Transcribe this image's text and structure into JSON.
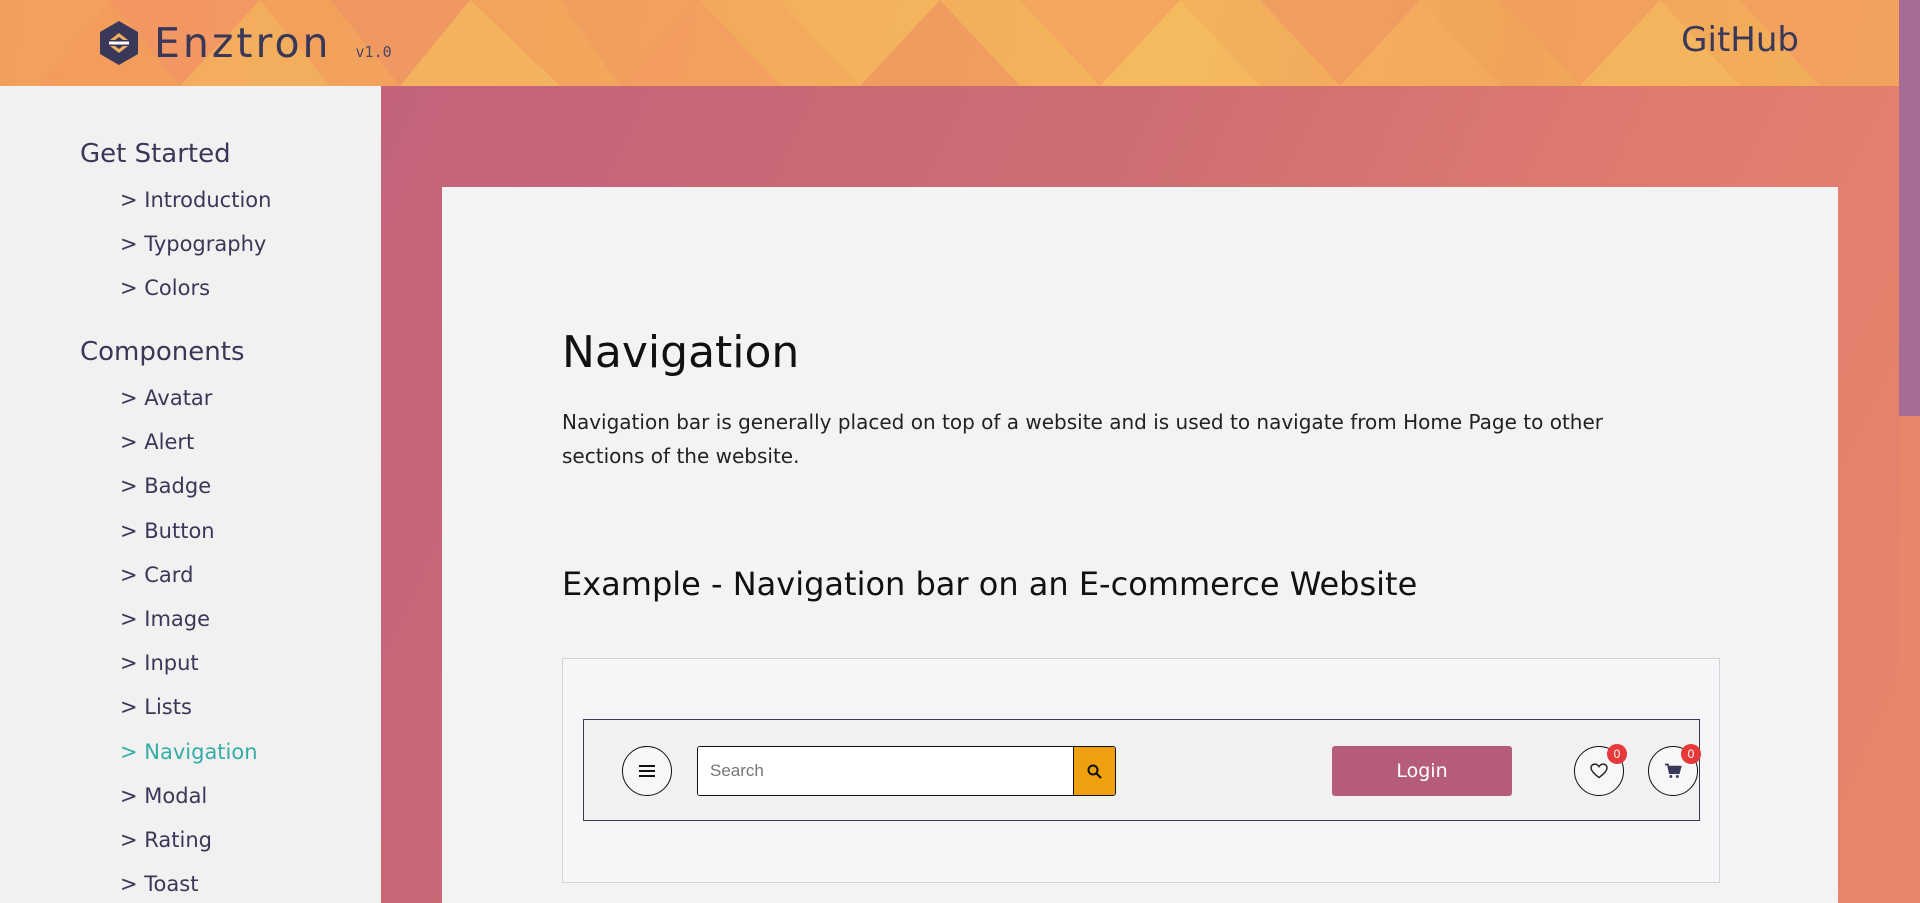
{
  "header": {
    "brand": "Enztron",
    "version": "v1.0",
    "github_label": "GitHub"
  },
  "sidebar": {
    "groups": [
      {
        "heading": "Get Started",
        "items": [
          "> Introduction",
          "> Typography",
          "> Colors"
        ]
      },
      {
        "heading": "Components",
        "items": [
          "> Avatar",
          "> Alert",
          "> Badge",
          "> Button",
          "> Card",
          "> Image",
          "> Input",
          "> Lists",
          "> Navigation",
          "> Modal",
          "> Rating",
          "> Toast"
        ]
      }
    ],
    "active_item": "> Navigation"
  },
  "main": {
    "title": "Navigation",
    "description": "Navigation bar is generally placed on top of a website and is used to navigate from Home Page to other sections of the website.",
    "example_title": "Example - Navigation bar on an E-commerce Website"
  },
  "demo_navbar": {
    "menu_icon": "hamburger-menu-icon",
    "search_placeholder": "Search",
    "search_icon": "search-icon",
    "login_label": "Login",
    "wishlist_icon": "heart-icon",
    "wishlist_count": "0",
    "cart_icon": "cart-icon",
    "cart_count": "0"
  },
  "colors": {
    "brand_dark": "#3a3858",
    "active_link": "#35aca6",
    "login_button": "#b55c79",
    "search_button": "#f0a00e",
    "badge": "#e5393a"
  }
}
